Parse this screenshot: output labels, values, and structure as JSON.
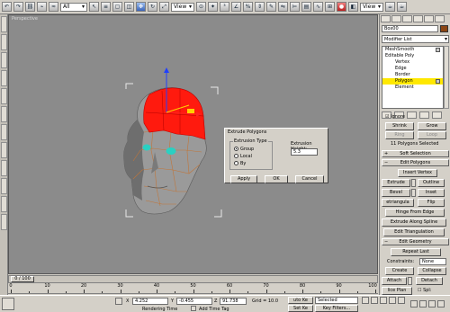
{
  "toolbar": {
    "filter_select": "All",
    "view_select": "View",
    "view_select_2": "View"
  },
  "viewport": {
    "label": "Perspective"
  },
  "dialog": {
    "title": "Extrude Polygons",
    "group_label": "Extrusion Type",
    "options": [
      "Group",
      "Local",
      "By"
    ],
    "selected_option": "Group",
    "height_label": "Extrusion Height:",
    "height_value": "5.3",
    "apply": "Apply",
    "ok": "OK",
    "cancel": "Cancel"
  },
  "command_panel": {
    "object_name": "Box00",
    "modifier_list": "Modifier List",
    "stack": [
      {
        "label": "MeshSmooth",
        "indent": false
      },
      {
        "label": "Editable Poly",
        "indent": false
      },
      {
        "label": "Vertex",
        "indent": true
      },
      {
        "label": "Edge",
        "indent": true
      },
      {
        "label": "Border",
        "indent": true
      },
      {
        "label": "Polygon",
        "indent": true
      },
      {
        "label": "Element",
        "indent": true
      }
    ],
    "selected_stack_item": "Polygon",
    "ignore_backfacing": "Ignore",
    "shrink": "Shrink",
    "grow": "Grow",
    "ring": "Ring",
    "loop": "Loop",
    "selection_status": "11 Polygons Selected",
    "soft_selection": "Soft Selection",
    "edit_polygons": "Edit Polygons",
    "insert_vertex": "Insert Vertex",
    "extrude": "Extrude",
    "outline": "Outline",
    "bevel": "Bevel",
    "inset": "Inset",
    "retriangulate": "etriangula",
    "flip": "Flip",
    "hinge_from_edge": "Hinge From Edge",
    "extrude_along_spline": "Extrude Along Spline",
    "edit_triangulation": "Edit Triangulation",
    "edit_geometry": "Edit Geometry",
    "repeat_last": "Repeat Last",
    "constraints_label": "Constraints:",
    "constraints_value": "None",
    "create": "Create",
    "collapse": "Collapse",
    "attach": "Attach",
    "detach": "Detach",
    "slice_plane": "lice Plan",
    "split": "Spl:"
  },
  "timeline": {
    "slider_label": "0 / 100",
    "ticks": [
      "0",
      "10",
      "20",
      "30",
      "40",
      "50",
      "60",
      "70",
      "80",
      "90",
      "100"
    ]
  },
  "status": {
    "x_value": "4.252",
    "y_value": "-0.455",
    "z_value": "91.738",
    "grid": "Grid = 10.0",
    "auto_key": "uto Ke",
    "selected": "Selected",
    "set_key": "Set Ke",
    "key_filters": "Key Filters...",
    "rendering_time": "Rendering Time",
    "add_time_tag": "Add Time Tag"
  }
}
